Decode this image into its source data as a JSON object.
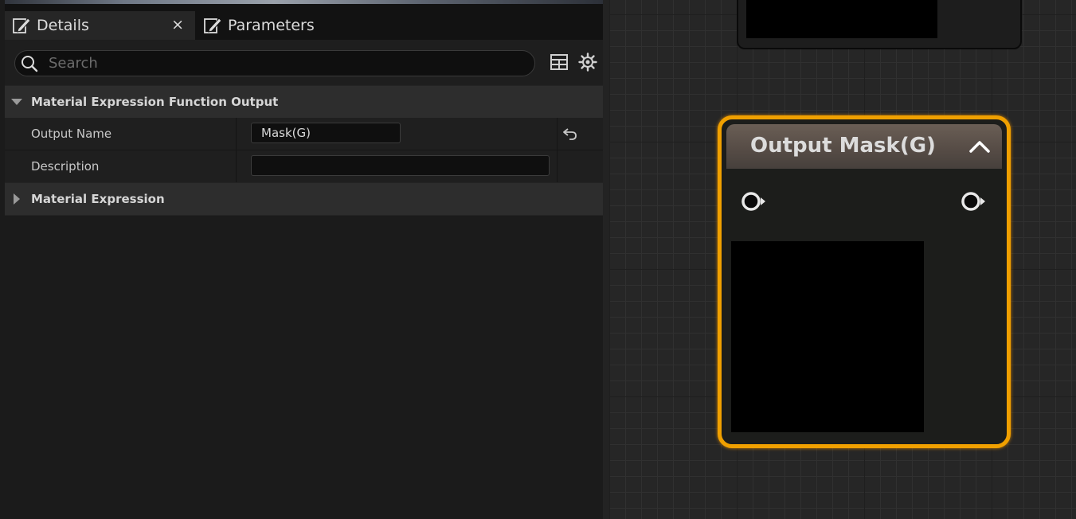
{
  "tabs": [
    {
      "label": "Details",
      "icon": "edit-icon",
      "active": true,
      "close": "×"
    },
    {
      "label": "Parameters",
      "icon": "edit-icon",
      "active": false
    }
  ],
  "search": {
    "placeholder": "Search",
    "value": ""
  },
  "toolbar": {
    "icons": [
      "table-view-icon",
      "settings-gear-icon"
    ]
  },
  "categories": [
    {
      "label": "Material Expression Function Output",
      "expanded": true,
      "properties": [
        {
          "label": "Output Name",
          "value": "Mask(G)"
        },
        {
          "label": "Description",
          "value": ""
        }
      ]
    },
    {
      "label": "Material Expression",
      "expanded": false
    }
  ],
  "node": {
    "title": "Output Mask(G)",
    "accent": "#f0a000"
  },
  "colors": {
    "panel": "#1b1b1b",
    "graph": "#262626",
    "selection": "#f0a000"
  }
}
